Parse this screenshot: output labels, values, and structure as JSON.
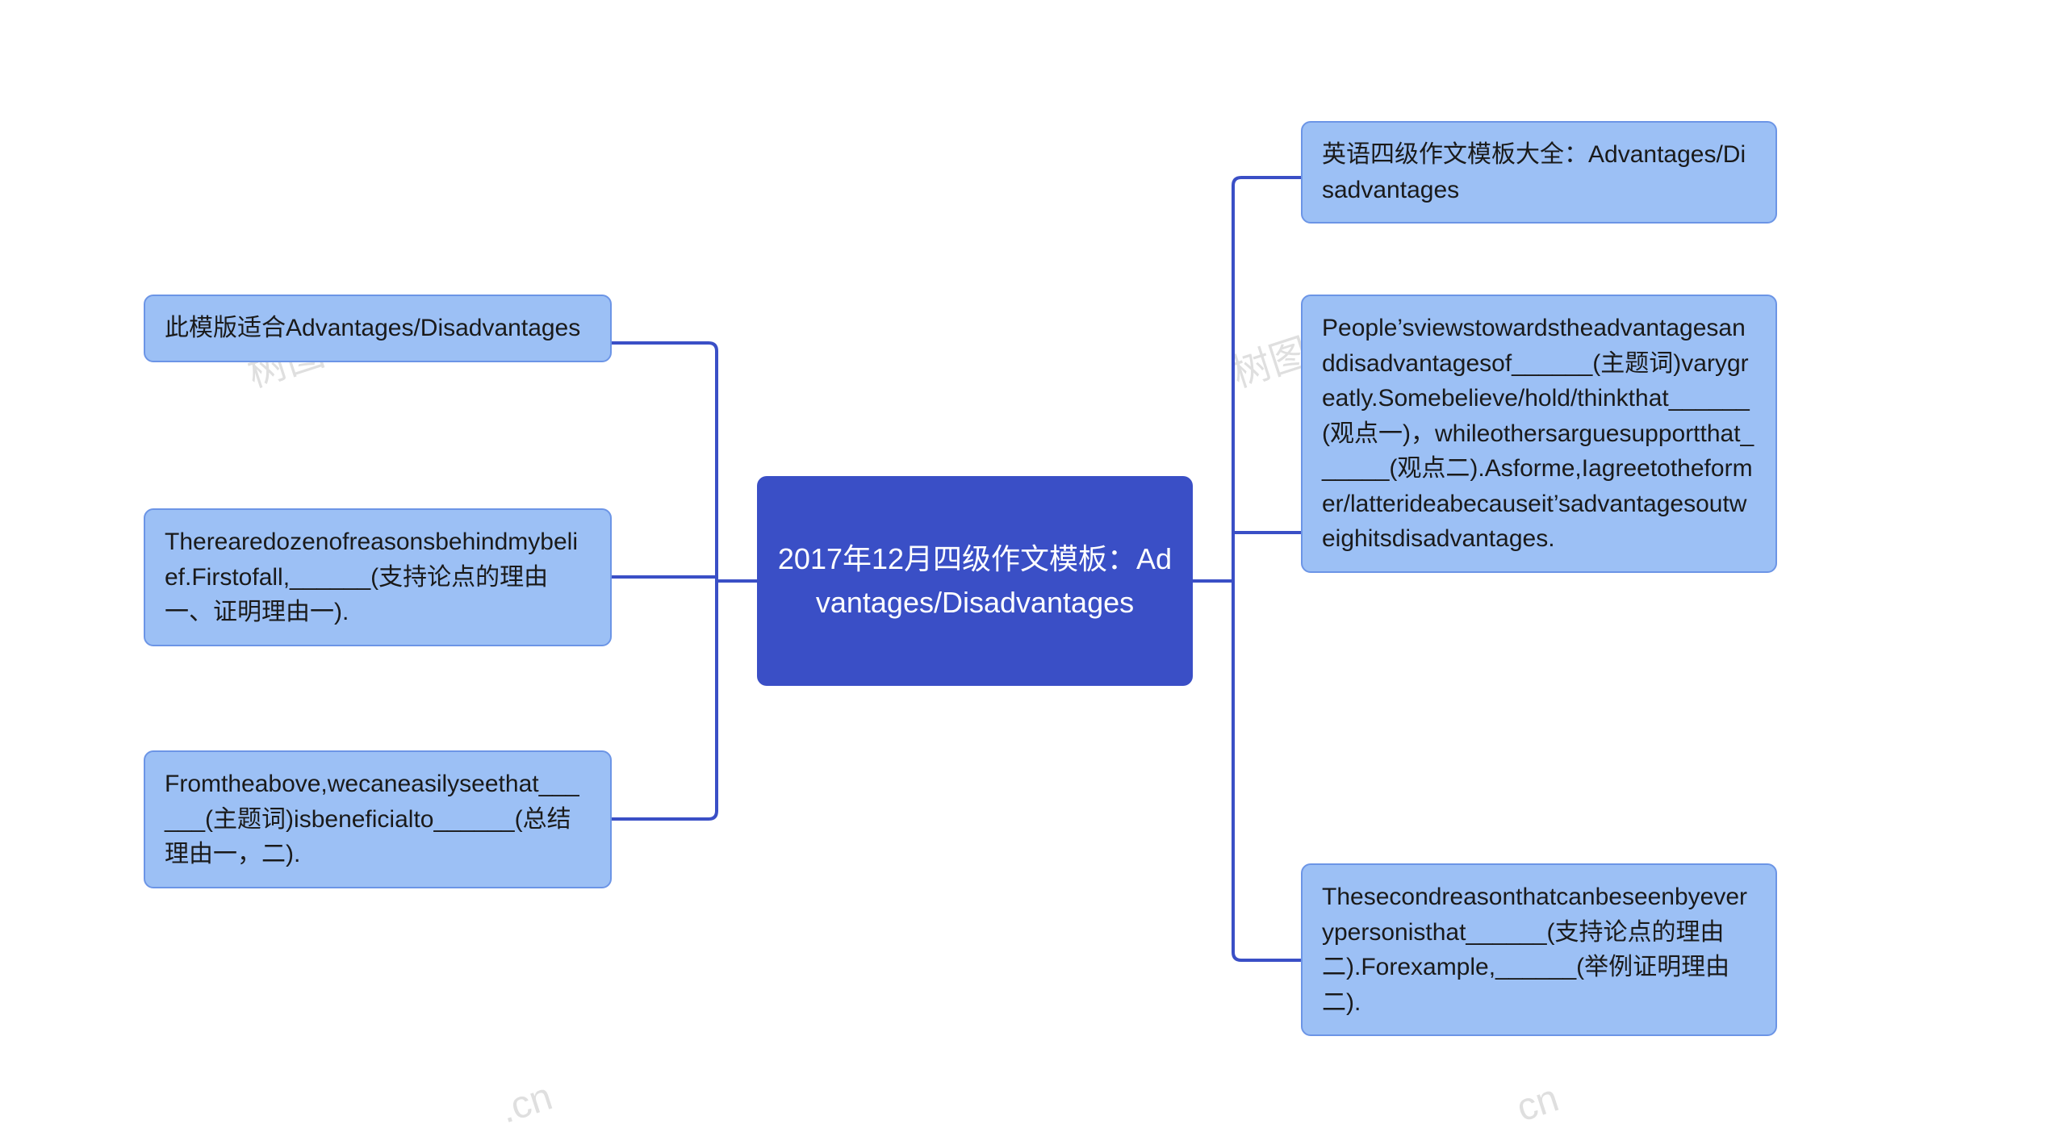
{
  "center": {
    "title": "2017年12月四级作文模板：Advantages/Disadvantages"
  },
  "left": [
    {
      "text": "此模版适合Advantages/Disadvantages"
    },
    {
      "text": "Therearedozenofreasonsbehindmybelief.Firstofall,______(支持论点的理由一、证明理由一)."
    },
    {
      "text": "Fromtheabove,wecaneasilyseethat______(主题词)isbeneficialto______(总结理由一，二)."
    }
  ],
  "right": [
    {
      "text": "英语四级作文模板大全：Advantages/Disadvantages"
    },
    {
      "text": "People’sviewstowardstheadvantagesanddisadvantagesof______(主题词)varygreatly.Somebelieve/hold/thinkthat______(观点一)，whileothersarguesupportthat______(观点二).Asforme,Iagreetotheformer/latterideabecauseit’sadvantagesoutweighitsdisadvantages."
    },
    {
      "text": "Thesecondreasonthatcanbeseenbyeverypersonisthat______(支持论点的理由二).Forexample,______(举例证明理由二)."
    }
  ],
  "watermarks": [
    "树图 shutu.cn",
    "树图 shutu.cn",
    ".cn",
    "cn"
  ],
  "colors": {
    "center_bg": "#3a4fc6",
    "leaf_bg": "#9cc0f5",
    "leaf_border": "#6c95e6",
    "connector": "#3a4fc6"
  }
}
